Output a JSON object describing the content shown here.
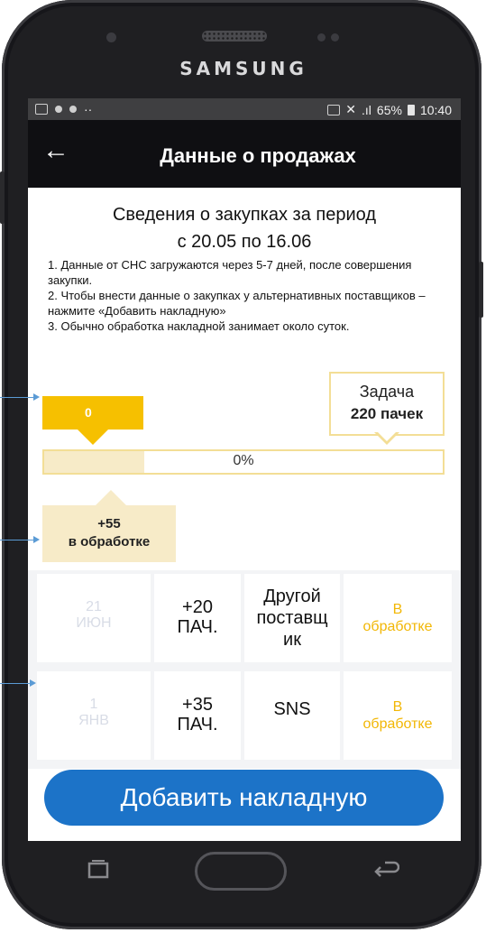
{
  "device": {
    "brand": "SAMSUNG"
  },
  "statusbar": {
    "battery": "65%",
    "time": "10:40"
  },
  "appbar": {
    "back_icon": "arrow-left-icon",
    "title": "Данные о продажах"
  },
  "header": {
    "line1": "Сведения о закупках за период",
    "line2": "с 20.05 по 16.06"
  },
  "notes": [
    "1. Данные от СНС загружаются через 5-7 дней, после совершения закупки.",
    "2. Чтобы внести данные о закупках у альтернативных поставщиков – нажмите «Добавить накладную»",
    "3. Обычно обработка накладной занимает около суток."
  ],
  "progress": {
    "current_value": "0",
    "target_label": "Задача",
    "target_value": "220 пачек",
    "percent_label": "0%",
    "percent": 0,
    "pending_fraction": 0.25,
    "pending_value": "+55",
    "pending_label": "в обработке"
  },
  "purchases": [
    {
      "day": "21",
      "month": "ИЮН",
      "qty": "+20",
      "unit": "ПАЧ.",
      "supplier": "Другой поставщ ик",
      "status_1": "В",
      "status_2": "обработке"
    },
    {
      "day": "1",
      "month": "ЯНВ",
      "qty": "+35",
      "unit": "ПАЧ.",
      "supplier": "SNS",
      "status_1": "В",
      "status_2": "обработке"
    }
  ],
  "add_button": {
    "label": "Добавить накладную"
  },
  "colors": {
    "accent_yellow": "#f6c000",
    "pending_bg": "#f7ebc8",
    "button_blue": "#1c73c8",
    "status_text": "#f2b705"
  }
}
